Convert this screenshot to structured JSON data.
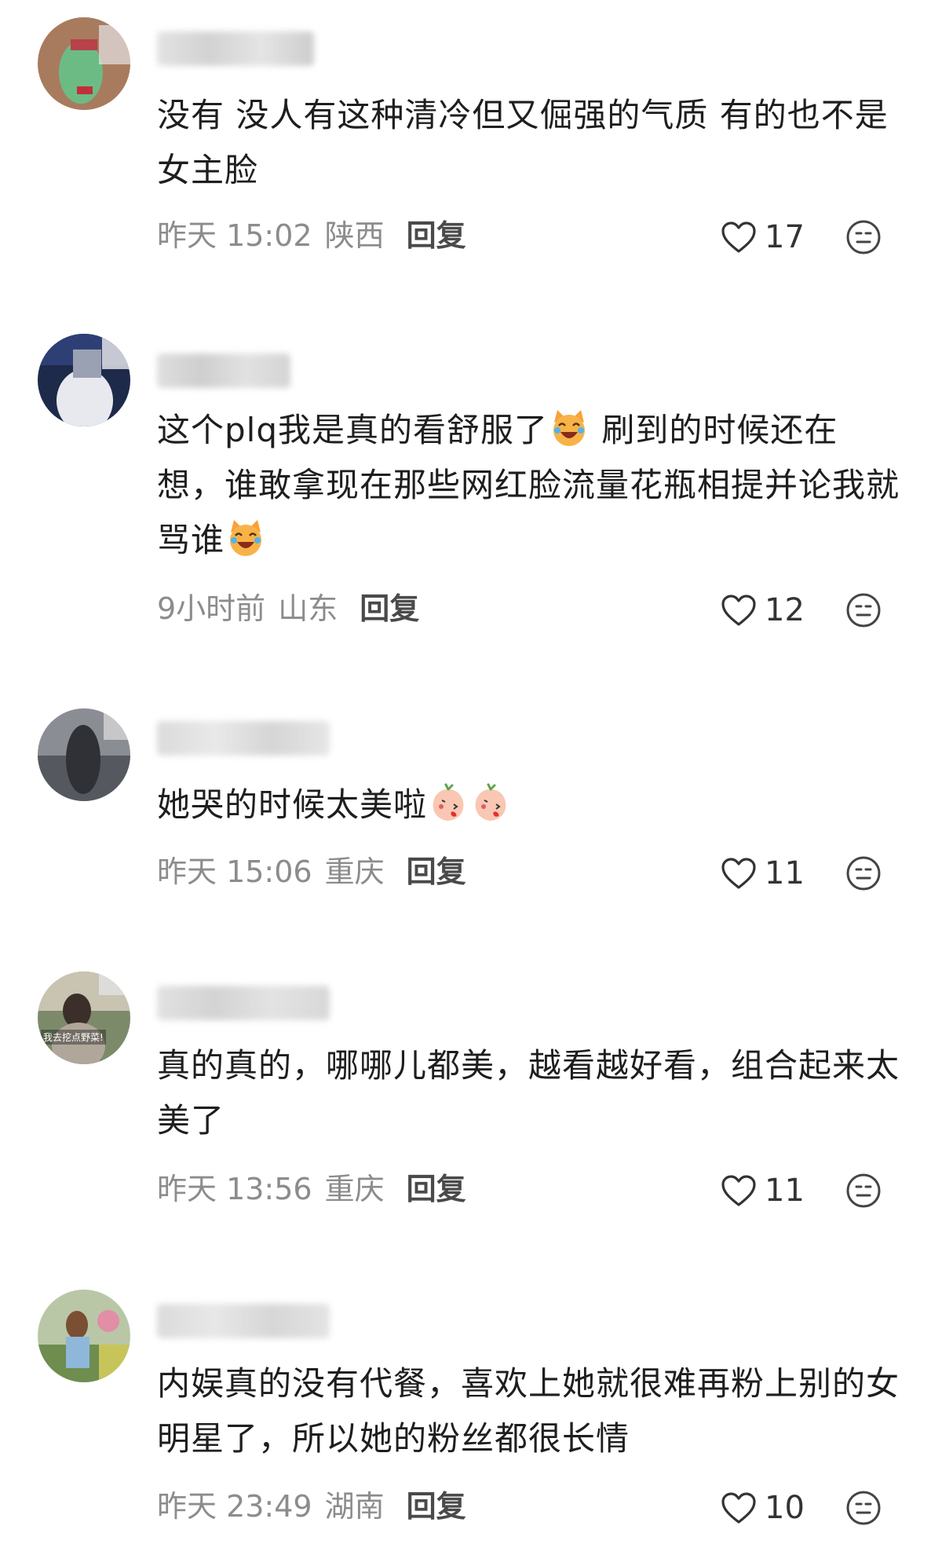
{
  "comments": [
    {
      "text": "没有 没人有这种清冷但又倔强的气质 有的也不是女主脸",
      "time": "昨天 15:02",
      "location": "陕西",
      "reply_label": "回复",
      "likes": "17"
    },
    {
      "text_part1": "这个plq我是真的看舒服了",
      "text_part2": " 刷到的时候还在想，谁敢拿现在那些网红脸流量花瓶相提并论我就骂谁",
      "emoji": "laughing-cat-emoji",
      "time": "9小时前",
      "location": "山东",
      "reply_label": "回复",
      "likes": "12"
    },
    {
      "text": "她哭的时候太美啦",
      "emoji": "peach-kiss-emoji",
      "time": "昨天 15:06",
      "location": "重庆",
      "reply_label": "回复",
      "likes": "11"
    },
    {
      "text": "真的真的，哪哪儿都美，越看越好看，组合起来太美了",
      "avatar_caption": "我去挖点野菜!",
      "time": "昨天 13:56",
      "location": "重庆",
      "reply_label": "回复",
      "likes": "11"
    },
    {
      "text": "内娱真的没有代餐，喜欢上她就很难再粉上别的女明星了，所以她的粉丝都很长情",
      "time": "昨天 23:49",
      "location": "湖南",
      "reply_label": "回复",
      "likes": "10"
    }
  ],
  "colors": {
    "meta_gray": "#8c8c8c",
    "reply_dark": "#4a4a4a",
    "text": "#1e1e1e"
  },
  "icons": {
    "like": "heart-outline-icon",
    "more": "neutral-face-icon"
  }
}
